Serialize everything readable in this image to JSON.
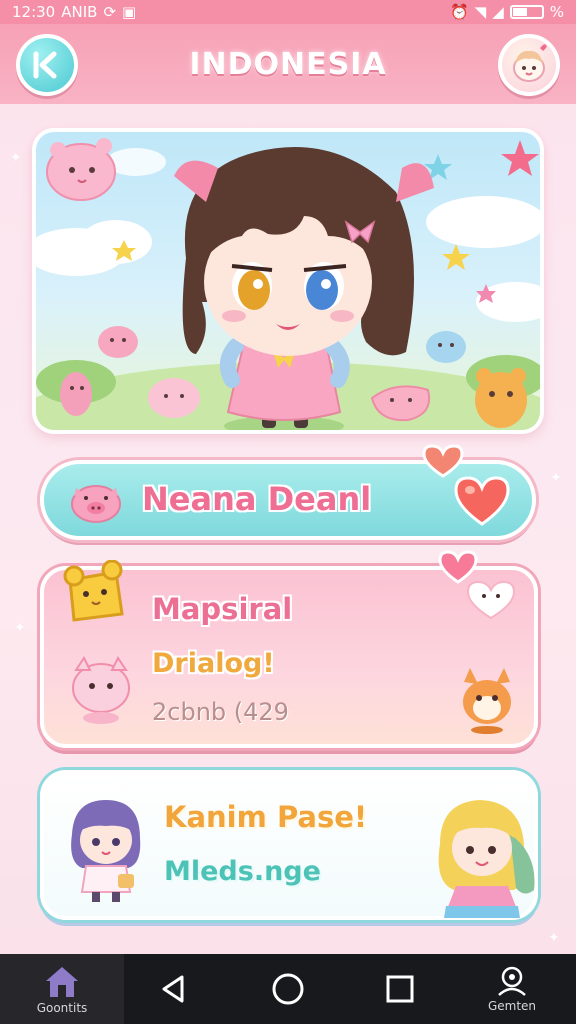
{
  "status_bar": {
    "time": "12:30",
    "left_text": "ANIB",
    "battery_text": "%"
  },
  "header": {
    "title": "INDONESIA"
  },
  "name_bar": {
    "name": "Neana Deanl"
  },
  "info_card": {
    "title": "Mapsiral",
    "dialog": "Drialog!",
    "count": "2cbnb (429"
  },
  "bottom_card": {
    "title": "Kanim Pase!",
    "subtitle": "Mleds.nge"
  },
  "nav": {
    "left_label": "Goontits",
    "right_label": "Gemten"
  },
  "colors": {
    "header_pink": "#f7a1b6",
    "accent_teal": "#7fd9dc",
    "title_pink": "#ec6f94",
    "title_orange": "#f1a53a",
    "subtitle_teal": "#4dc3b7"
  }
}
